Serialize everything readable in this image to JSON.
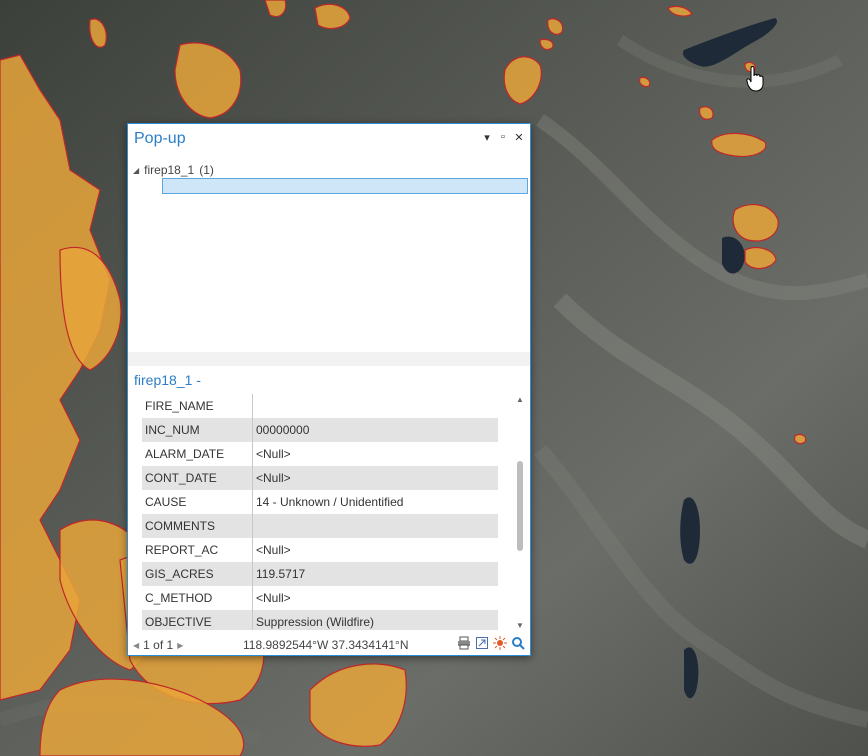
{
  "popup": {
    "title": "Pop-up",
    "layer_item": "firep18_1",
    "layer_count": "(1)",
    "feature_title": "firep18_1 -",
    "fields": [
      {
        "key": "FIRE_NAME",
        "value": ""
      },
      {
        "key": "INC_NUM",
        "value": "00000000"
      },
      {
        "key": "ALARM_DATE",
        "value": "<Null>"
      },
      {
        "key": "CONT_DATE",
        "value": "<Null>"
      },
      {
        "key": "CAUSE",
        "value": "14 - Unknown / Unidentified"
      },
      {
        "key": "COMMENTS",
        "value": ""
      },
      {
        "key": "REPORT_AC",
        "value": "<Null>"
      },
      {
        "key": "GIS_ACRES",
        "value": "119.5717"
      },
      {
        "key": "C_METHOD",
        "value": "<Null>"
      },
      {
        "key": "OBJECTIVE",
        "value": "Suppression (Wildfire)"
      }
    ],
    "pager": "1 of 1",
    "coordinates": "118.9892544°W 37.3434141°N"
  },
  "icons": {
    "window_buttons": [
      "dropdown-icon",
      "maximize-icon",
      "close-icon"
    ],
    "status_tools": [
      "print-icon",
      "export-icon",
      "flash-icon",
      "zoom-to-icon"
    ]
  },
  "colors": {
    "fire_fill": "#e8a53a",
    "fire_outline": "#c0262a",
    "accent": "#2a7ec8"
  }
}
